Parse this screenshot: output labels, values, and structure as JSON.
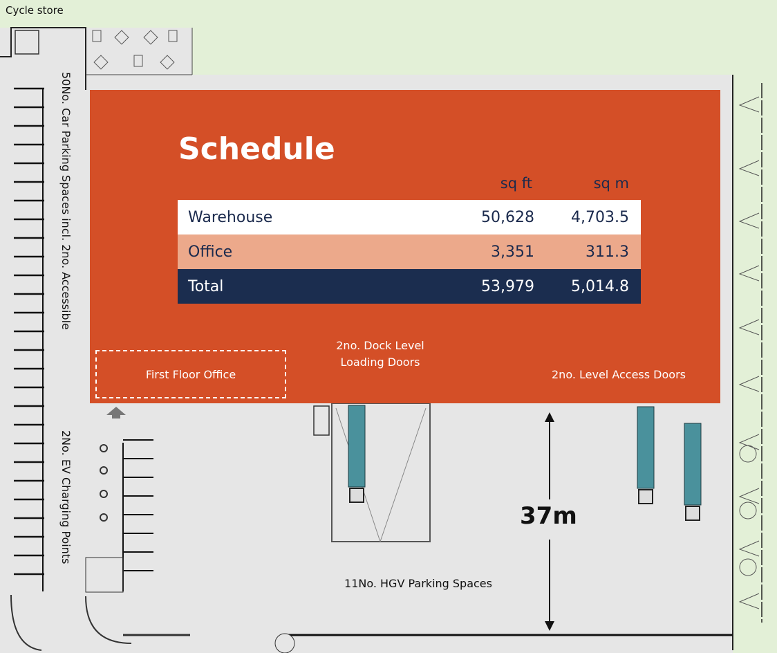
{
  "labels": {
    "cycle_store": "Cycle store",
    "car_parking": "50No. Car Parking Spaces incl. 2no. Accessible",
    "ev_charging": "2No. EV Charging Points",
    "first_floor_office": "First Floor Office",
    "dock_doors": "2no. Dock Level Loading Doors",
    "level_access_doors": "2no. Level Access  Doors",
    "yard_depth": "37m",
    "hgv_parking": "11No. HGV Parking Spaces"
  },
  "schedule": {
    "title": "Schedule",
    "col_sqft": "sq ft",
    "col_sqm": "sq m",
    "rows": [
      {
        "name": "Warehouse",
        "sqft": "50,628",
        "sqm": "4,703.5"
      },
      {
        "name": "Office",
        "sqft": "3,351",
        "sqm": "311.3"
      },
      {
        "name": "Total",
        "sqft": "53,979",
        "sqm": "5,014.8"
      }
    ]
  },
  "colors": {
    "building": "#d44f27",
    "table_total": "#1b2d4f",
    "table_office": "#eca98b",
    "vehicle": "#4a919c",
    "grass": "#e3f0d7",
    "hardstanding": "#e6e6e6"
  }
}
